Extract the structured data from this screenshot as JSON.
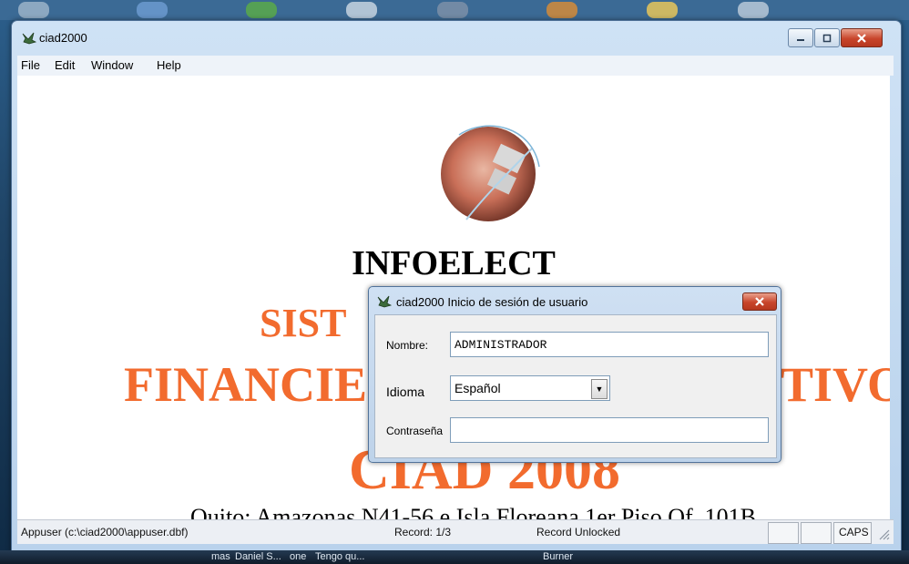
{
  "window": {
    "title": "ciad2000"
  },
  "menu": {
    "items": [
      "File",
      "Edit",
      "Window",
      "Help"
    ]
  },
  "content": {
    "company": "INFOELECT",
    "line1_visible": "SIST",
    "line2_left_visible": "FINANCIE",
    "line2_right_visible": "TIVO",
    "line3_visible": "CIAD 2008",
    "address": "Quito: Amazonas N41-56 e Isla Floreana  1er Piso Of. 101B"
  },
  "dialog": {
    "title": "ciad2000 Inicio de sesión de usuario",
    "nombre_label": "Nombre:",
    "nombre_value": "ADMINISTRADOR",
    "idioma_label": "Idioma",
    "idioma_value": "Español",
    "contrasena_label": "Contraseña",
    "contrasena_value": ""
  },
  "status": {
    "file": "Appuser (c:\\ciad2000\\appuser.dbf)",
    "record": "Record: 1/3",
    "lock": "Record Unlocked",
    "caps": "CAPS"
  },
  "taskbar": {
    "items": [
      "mas",
      "Daniel S...",
      "one",
      "Tengo qu...",
      "Burner"
    ]
  },
  "colors": {
    "accent_orange": "#f26b2e",
    "close_red": "#c8452b"
  },
  "icons": [
    "app-icon",
    "minimize-icon",
    "maximize-icon",
    "close-icon",
    "dropdown-arrow-icon",
    "resize-grip-icon"
  ]
}
